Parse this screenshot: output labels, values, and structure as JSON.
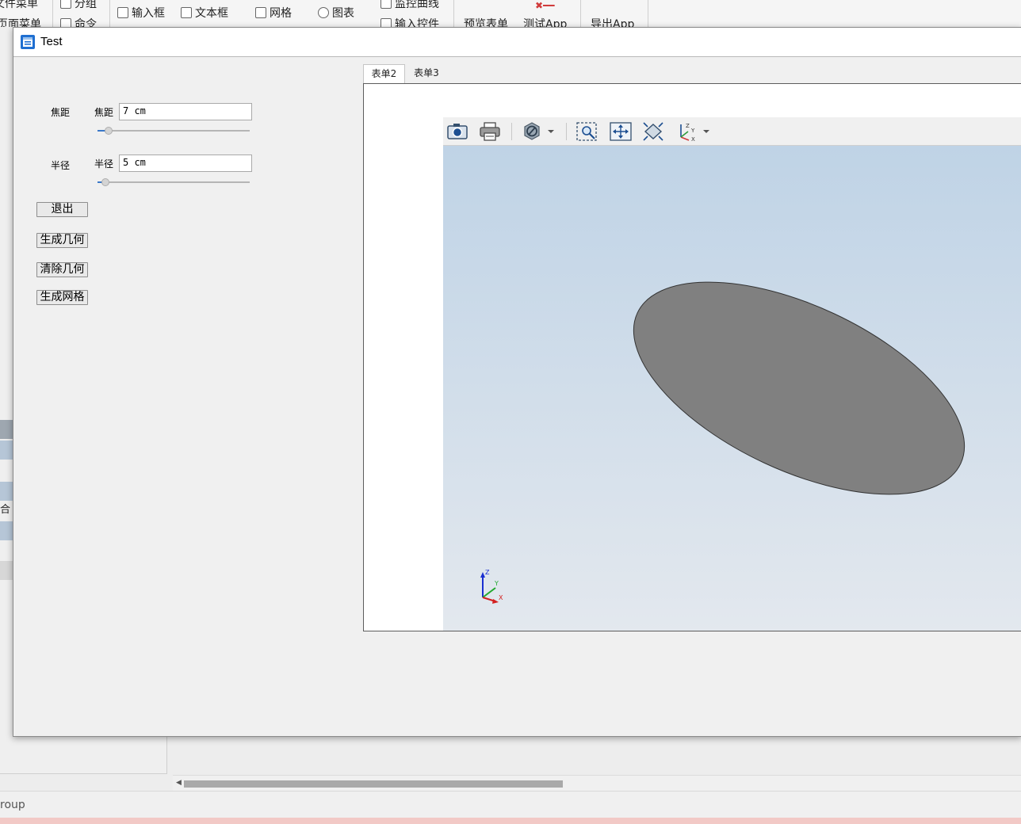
{
  "background_app": {
    "ribbon": {
      "file_menu": "文件菜单",
      "page_menu": "页面菜单",
      "group": "分组",
      "command": "命令",
      "input_box": "输入框",
      "text_box": "文本框",
      "mesh": "网格",
      "chart": "图表",
      "monitor_curve": "监控曲线",
      "input_control": "输入控件",
      "preview_form": "预览表单",
      "test_app": "测试App",
      "export_app": "导出App"
    },
    "left_row_label": "合",
    "status_text": "roup"
  },
  "dialog": {
    "title": "Test",
    "focal": {
      "group_label": "焦距",
      "field_label": "焦距",
      "value": "7 cm",
      "slider_fraction": 0.05
    },
    "radius": {
      "group_label": "半径",
      "field_label": "半径",
      "value": "5 cm",
      "slider_fraction": 0.03
    },
    "buttons": {
      "exit": "退出",
      "build_geometry": "生成几何",
      "clear_geometry": "清除几何",
      "build_mesh": "生成网格"
    },
    "tabs": [
      "表单2",
      "表单3"
    ],
    "active_tab": "表单2",
    "graphics": {
      "toolbar_icons": [
        "camera-icon",
        "print-icon",
        "hide-icon",
        "zoom-box-icon",
        "zoom-extents-icon",
        "fit-view-icon",
        "axis-orientation-icon"
      ],
      "triad_labels": {
        "z": "Z",
        "y": "Y",
        "x": "X"
      },
      "shape_fill": "#808080",
      "viewport_top": "#bfd3e6",
      "viewport_bottom": "#e3e8ee"
    }
  }
}
